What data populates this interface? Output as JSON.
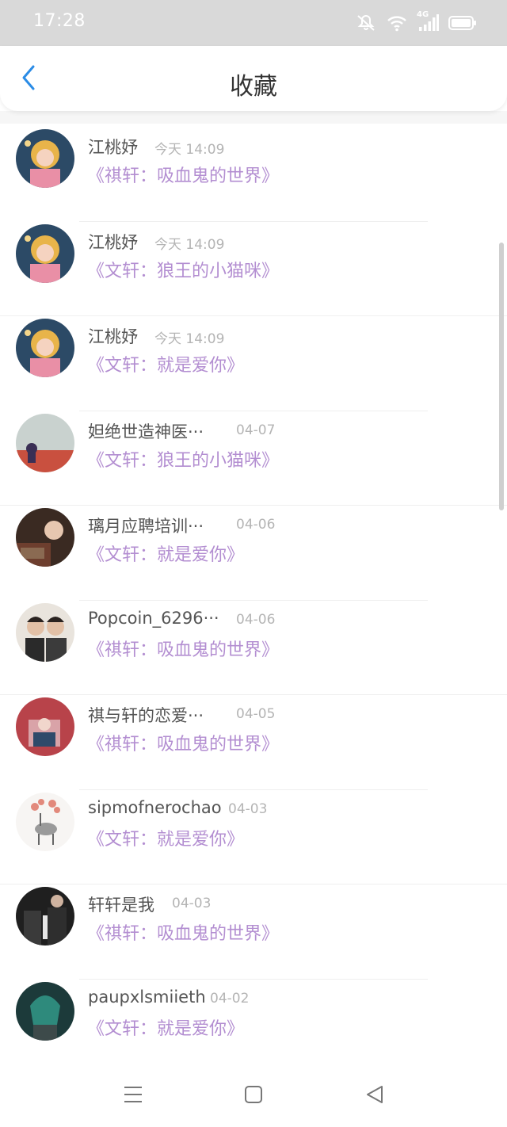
{
  "status_bar": {
    "time": "17:28",
    "icons": [
      "mute-icon",
      "wifi-icon",
      "signal-4g-icon",
      "battery-icon"
    ],
    "network_label": "4G"
  },
  "header": {
    "title": "收藏",
    "back_icon": "chevron-left-icon",
    "accent_color": "#2b8ce6"
  },
  "items": [
    {
      "name": "江桃妤",
      "time": "今天  14:09",
      "title": "《祺轩：吸血鬼的世界》"
    },
    {
      "name": "江桃妤",
      "time": "今天  14:09",
      "title": "《文轩：狼王的小猫咪》"
    },
    {
      "name": "江桃妤",
      "time": "今天  14:09",
      "title": "《文轩：就是爱你》"
    },
    {
      "name": "妲绝世造神医···",
      "time": "04-07",
      "title": "《文轩：狼王的小猫咪》"
    },
    {
      "name": "璃月应聘培训···",
      "time": "04-06",
      "title": "《文轩：就是爱你》"
    },
    {
      "name": "Popcoin_6296···",
      "time": "04-06",
      "title": "《祺轩：吸血鬼的世界》"
    },
    {
      "name": "祺与轩的恋爱···",
      "time": "04-05",
      "title": "《祺轩：吸血鬼的世界》"
    },
    {
      "name": "sipmofnerochao",
      "time": "04-03",
      "title": "《文轩：就是爱你》"
    },
    {
      "name": "轩轩是我",
      "time": "04-03",
      "title": "《祺轩：吸血鬼的世界》"
    },
    {
      "name": "paupxlsmiieth",
      "time": "04-02",
      "title": "《文轩：就是爱你》"
    }
  ],
  "title_color": "#b38ed1",
  "nav_bar": {
    "icons": [
      "menu-icon",
      "home-square-icon",
      "back-triangle-icon"
    ]
  }
}
